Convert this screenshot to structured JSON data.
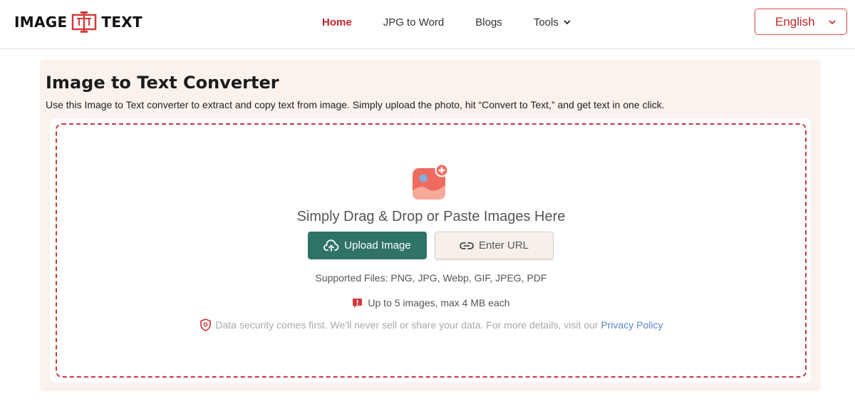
{
  "header": {
    "logo_left": "IMAGE",
    "logo_right": "TEXT",
    "logo_icon": "text-cursor-logo-icon",
    "nav": [
      {
        "label": "Home",
        "active": true
      },
      {
        "label": "JPG to Word",
        "active": false
      },
      {
        "label": "Blogs",
        "active": false
      },
      {
        "label": "Tools",
        "active": false,
        "has_dropdown": true
      }
    ],
    "language": "English"
  },
  "main": {
    "title": "Image to Text Converter",
    "description": "Use this Image to Text converter to extract and copy text from image. Simply upload the photo, hit “Convert to Text,” and get text in one click.",
    "dropzone": {
      "icon": "add-image-icon",
      "prompt": "Simply Drag & Drop or Paste Images Here",
      "upload_label": "Upload Image",
      "url_label": "Enter URL",
      "supported": "Supported Files: PNG, JPG, Webp, GIF, JPEG, PDF",
      "limit": "Up to 5 images, max 4 MB each",
      "security_text": "Data security comes first. We'll never sell or share your data. For more details, visit our",
      "privacy_link": "Privacy Policy"
    }
  },
  "colors": {
    "accent_red": "#c0262d",
    "upload_green": "#2f7367",
    "panel_bg": "#faf2ed",
    "link_blue": "#5a86c9"
  }
}
